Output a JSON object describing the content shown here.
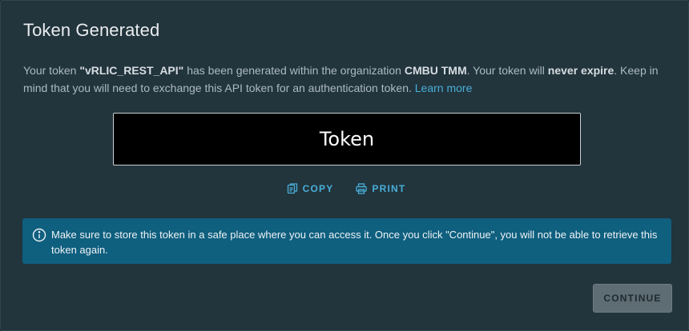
{
  "modal": {
    "title": "Token Generated",
    "description": {
      "part1": "Your token ",
      "token_name": "\"vRLIC_REST_API\"",
      "part2": " has been generated within the organization ",
      "org_name": "CMBU TMM",
      "part3": ". Your token will ",
      "expiry": "never expire",
      "part4": ". Keep in mind that you will need to exchange this API token for an authentication token. ",
      "learn_more": "Learn more"
    },
    "token_value": "Token",
    "actions": {
      "copy_label": "COPY",
      "copy_icon": "copy-icon",
      "print_label": "PRINT",
      "print_icon": "print-icon"
    },
    "alert": {
      "icon": "info-icon",
      "text": "Make sure to store this token in a safe place where you can access it. Once you click \"Continue\", you will not be able to retrieve this token again."
    },
    "continue_label": "CONTINUE"
  },
  "colors": {
    "background": "#22343c",
    "accent_link": "#49afd9",
    "alert_bg": "#0f5f7f",
    "button_bg": "#5e6c73"
  }
}
